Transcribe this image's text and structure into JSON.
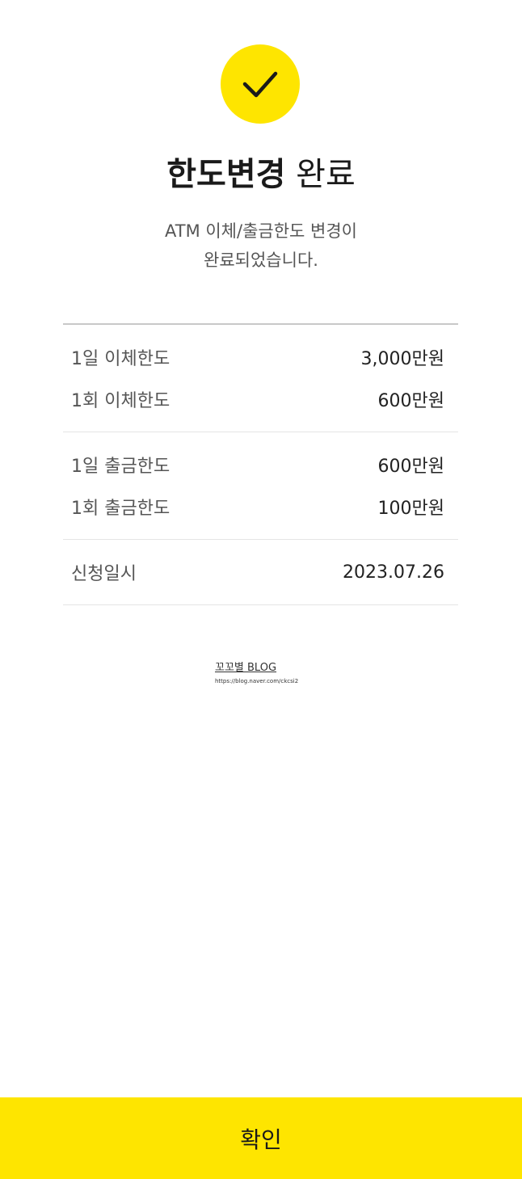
{
  "header": {
    "icon": "check-icon",
    "title_bold": "한도변경",
    "title_normal": "완료",
    "message_line1": "ATM 이체/출금한도 변경이",
    "message_line2": "완료되었습니다."
  },
  "details": {
    "transfer": [
      {
        "label": "1일 이체한도",
        "value": "3,000만원"
      },
      {
        "label": "1회 이체한도",
        "value": "600만원"
      }
    ],
    "withdrawal": [
      {
        "label": "1일 출금한도",
        "value": "600만원"
      },
      {
        "label": "1회 출금한도",
        "value": "100만원"
      }
    ],
    "application": [
      {
        "label": "신청일시",
        "value": "2023.07.26"
      }
    ]
  },
  "watermark": {
    "title": "꼬꼬별 BLOG",
    "url": "https://blog.naver.com/ckcsi2"
  },
  "footer": {
    "confirm_label": "확인"
  },
  "colors": {
    "accent": "#FEE500",
    "text_primary": "#222222",
    "text_secondary": "#555555",
    "divider": "#e5e5e5"
  }
}
